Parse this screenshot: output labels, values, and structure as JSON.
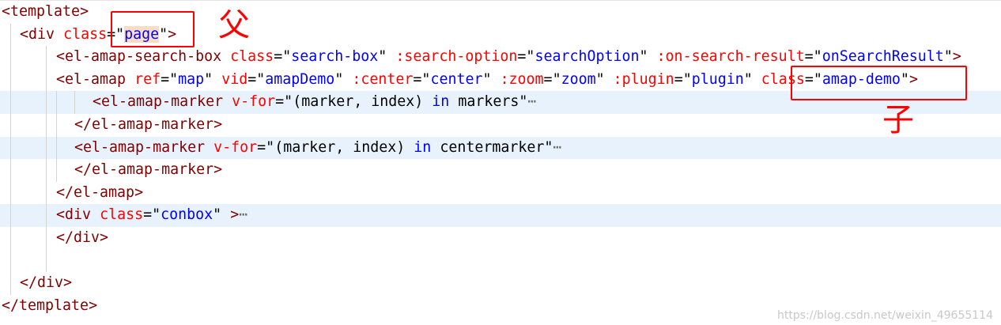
{
  "colors": {
    "tag": "#800000",
    "attribute": "#ff0000",
    "string": "#0000ff",
    "keyword": "#0000ff",
    "highlight_line": "#e8f2fc",
    "selection": "#f9dcc4",
    "annotation": "#ff0000"
  },
  "code_lines": [
    {
      "text": "<template>",
      "highlight": false
    },
    {
      "text": "<div class=\"page\">",
      "highlight": false
    },
    {
      "text": "<el-amap-search-box class=\"search-box\" :search-option=\"searchOption\" :on-search-result=\"onSearchResult\">",
      "highlight": false
    },
    {
      "text": "<el-amap ref=\"map\" vid=\"amapDemo\" :center=\"center\" :zoom=\"zoom\" :plugin=\"plugin\" class=\"amap-demo\">",
      "highlight": false
    },
    {
      "text": "<el-amap-marker v-for=\"(marker, index) in markers\"…",
      "highlight": true,
      "folded": true
    },
    {
      "text": "</el-amap-marker>",
      "highlight": false
    },
    {
      "text": "<el-amap-marker v-for=\"(marker, index) in centermarker\"…",
      "highlight": true,
      "folded": true
    },
    {
      "text": "</el-amap-marker>",
      "highlight": false
    },
    {
      "text": "</el-amap>",
      "highlight": false
    },
    {
      "text": "<div class=\"conbox\" >…",
      "highlight": true,
      "folded": true
    },
    {
      "text": "</div>",
      "highlight": false
    },
    {
      "text": "",
      "highlight": false
    },
    {
      "text": "</div>",
      "highlight": false
    },
    {
      "text": "</template>",
      "highlight": false
    }
  ],
  "annotations": {
    "parent_label": "父",
    "child_label": "子"
  },
  "watermark": "https://blog.csdn.net/weixin_49655114"
}
